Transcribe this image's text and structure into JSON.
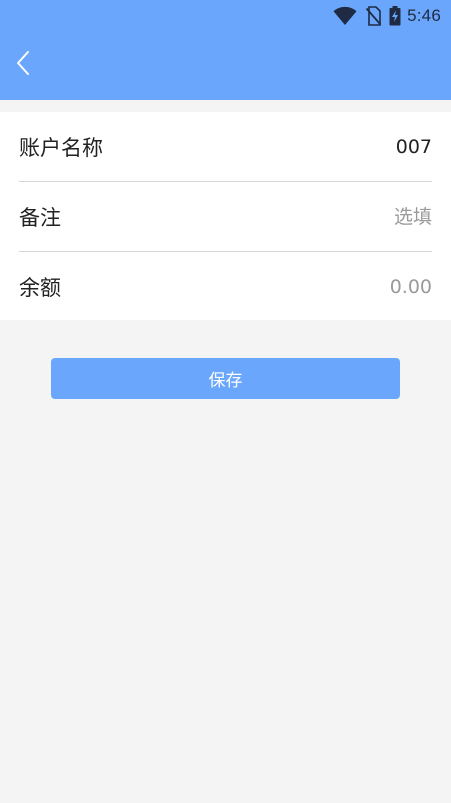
{
  "status_bar": {
    "time": "5:46",
    "icons": [
      "wifi-icon",
      "no-sim-icon",
      "battery-charging-icon"
    ]
  },
  "header": {
    "back_icon": "chevron-left-icon"
  },
  "form": {
    "account_name": {
      "label": "账户名称",
      "value": "007"
    },
    "remark": {
      "label": "备注",
      "value": "",
      "placeholder": "选填"
    },
    "balance": {
      "label": "余额",
      "value": "",
      "placeholder": "0.00"
    }
  },
  "actions": {
    "save_label": "保存"
  },
  "colors": {
    "primary": "#6aa6fb",
    "background": "#f4f4f4",
    "surface": "#ffffff",
    "divider": "#d6d6d6",
    "text": "#222222",
    "placeholder": "#9a9a9a"
  }
}
